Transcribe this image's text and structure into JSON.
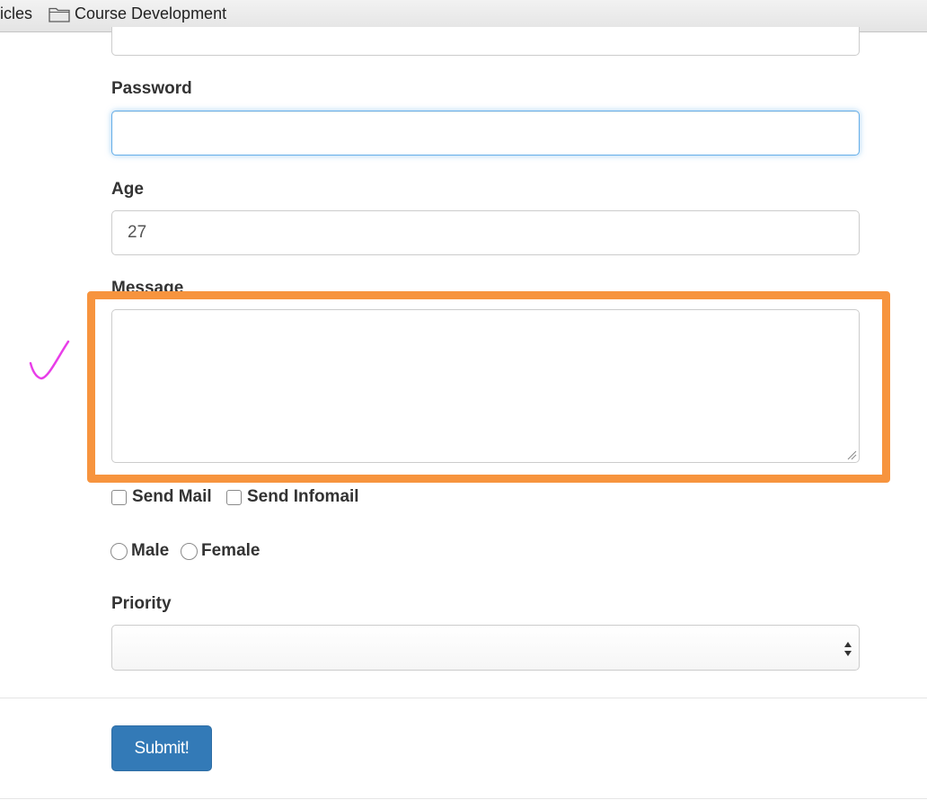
{
  "bookmarks_bar": {
    "items": [
      {
        "label": "icles",
        "icon": "none"
      },
      {
        "label": "Course Development",
        "icon": "folder-icon"
      }
    ]
  },
  "form": {
    "password": {
      "label": "Password",
      "value": "",
      "focused": true
    },
    "age": {
      "label": "Age",
      "value": "27"
    },
    "message": {
      "label": "Message",
      "value": ""
    },
    "checkboxes": [
      {
        "label": "Send Mail",
        "checked": false
      },
      {
        "label": "Send Infomail",
        "checked": false
      }
    ],
    "gender_radios": [
      {
        "label": "Male",
        "selected": false
      },
      {
        "label": "Female",
        "selected": false
      }
    ],
    "priority": {
      "label": "Priority",
      "selected": ""
    },
    "submit_label": "Submit!"
  },
  "annotations": {
    "highlight_color": "#f7943e",
    "checkmark_color": "#e83ee8"
  },
  "colors": {
    "primary_button": "#337ab7",
    "focus_border": "#66afe9"
  }
}
